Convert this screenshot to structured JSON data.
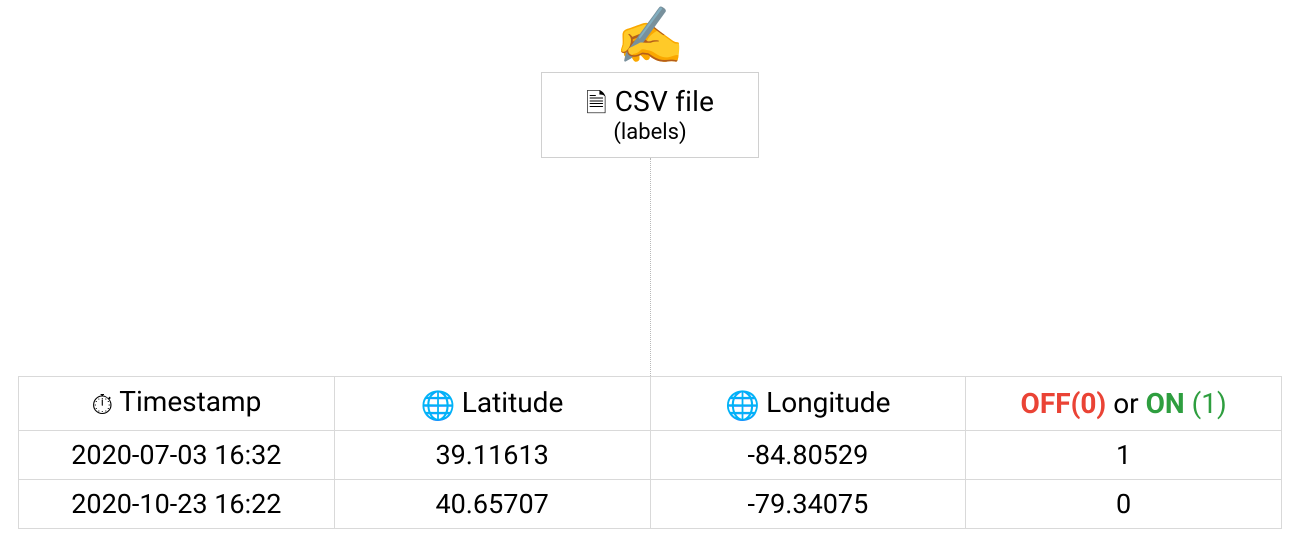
{
  "icons": {
    "writing_hand": "✍️",
    "document": "🗎",
    "stopwatch": "⏱",
    "globe": "🌐"
  },
  "csv_node": {
    "title": "CSV file",
    "subtitle": "(labels)"
  },
  "table": {
    "headers": {
      "timestamp": "Timestamp",
      "latitude": "Latitude",
      "longitude": "Longitude",
      "labelcol": {
        "off_text": "OFF",
        "off_value": "(0)",
        "or_text": " or ",
        "on_text": "ON",
        "on_value": " (1)"
      }
    },
    "rows": [
      {
        "timestamp": "2020-07-03 16:32",
        "latitude": "39.11613",
        "longitude": "-84.80529",
        "label": "1"
      },
      {
        "timestamp": "2020-10-23 16:22",
        "latitude": "40.65707",
        "longitude": "-79.34075",
        "label": "0"
      }
    ]
  },
  "chart_data": {
    "type": "table",
    "title": "CSV file (labels)",
    "columns": [
      "Timestamp",
      "Latitude",
      "Longitude",
      "OFF(0) or ON (1)"
    ],
    "rows": [
      [
        "2020-07-03 16:32",
        39.11613,
        -84.80529,
        1
      ],
      [
        "2020-10-23 16:22",
        40.65707,
        -79.34075,
        0
      ]
    ]
  }
}
